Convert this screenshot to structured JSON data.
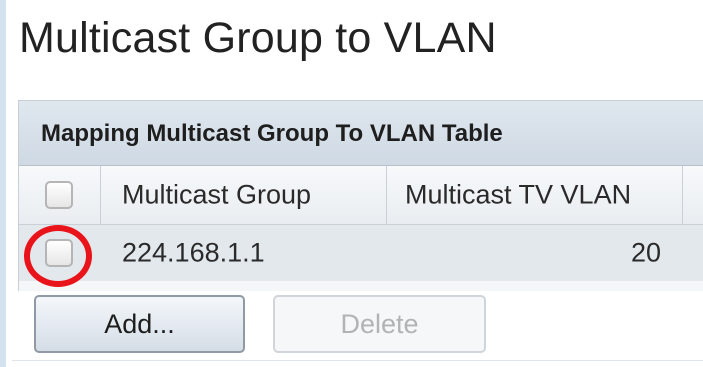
{
  "page": {
    "title": "Multicast Group to VLAN"
  },
  "table": {
    "caption": "Mapping Multicast Group To VLAN Table",
    "columns": [
      "",
      "Multicast Group",
      "Multicast TV VLAN"
    ],
    "rows": [
      {
        "selected": false,
        "multicast_group": "224.168.1.1",
        "multicast_tv_vlan": "20"
      }
    ],
    "select_all_checked": false
  },
  "buttons": {
    "add_label": "Add...",
    "delete_label": "Delete",
    "delete_enabled": false
  },
  "annotation": {
    "highlight": "row-checkbox",
    "color": "#e8141a"
  },
  "colors": {
    "caption_bg": "#d6dfe8",
    "row_bg": "#e3e8ed",
    "frame_border": "#d4e1ee"
  }
}
